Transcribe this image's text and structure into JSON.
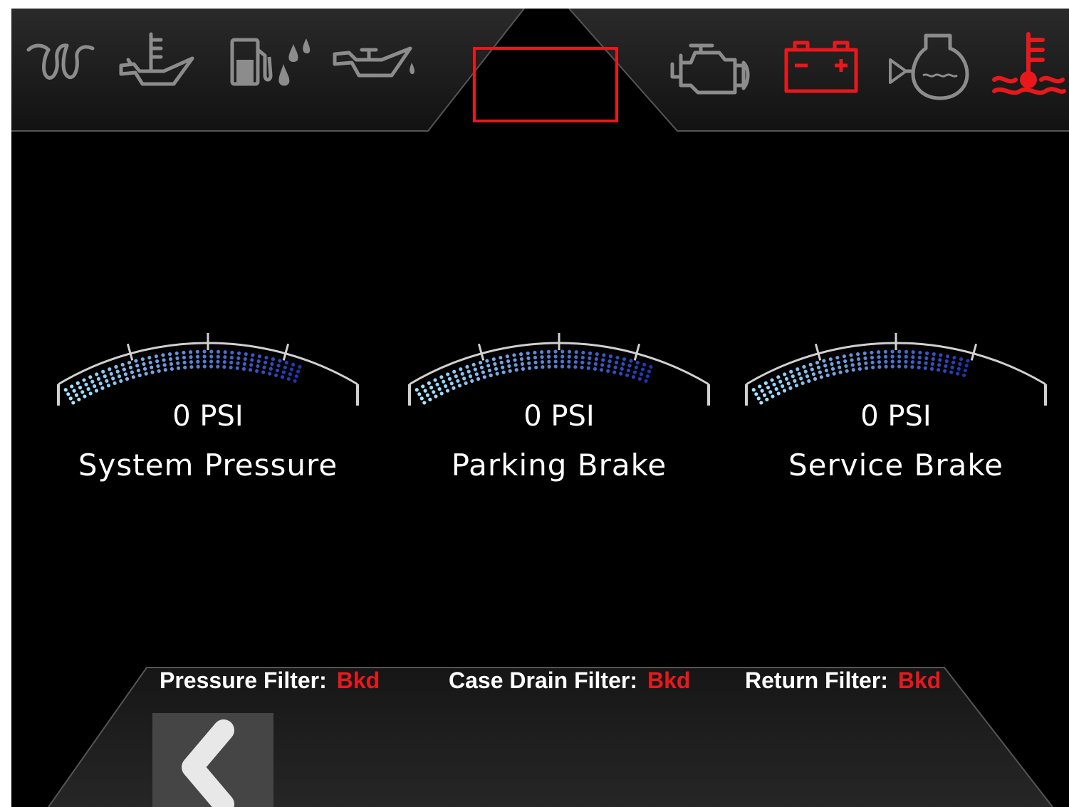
{
  "top_bar": {
    "left_icons": [
      "glow-plug-icon",
      "oil-temperature-icon",
      "fuel-water-separator-icon",
      "oil-pressure-icon"
    ],
    "right_icons": [
      "check-engine-icon",
      "battery-icon",
      "air-filter-icon",
      "coolant-temperature-icon"
    ],
    "active_warning_color": "#e8181c",
    "inactive_icon_color": "#8c8c8c"
  },
  "gauges": [
    {
      "value": "0 PSI",
      "label": "System Pressure",
      "fill": 0.82
    },
    {
      "value": "0 PSI",
      "label": "Parking Brake",
      "fill": 0.82
    },
    {
      "value": "0 PSI",
      "label": "Service Brake",
      "fill": 0.75
    }
  ],
  "filters": [
    {
      "label": "Pressure Filter:",
      "status": "Bkd"
    },
    {
      "label": "Case Drain Filter:",
      "status": "Bkd"
    },
    {
      "label": "Return Filter:",
      "status": "Bkd"
    }
  ],
  "navigation": {
    "back_icon": "chevron-left-icon"
  },
  "colors": {
    "gauge_fill_start": "#a8e6ff",
    "gauge_fill_end": "#1a2fb0",
    "background": "#000000"
  }
}
